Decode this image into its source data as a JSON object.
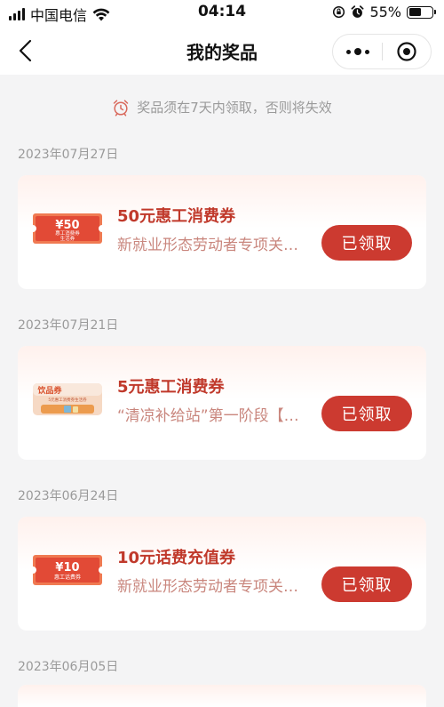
{
  "status_bar": {
    "carrier": "中国电信",
    "time": "04:14",
    "battery_percent": "55%",
    "battery_level": 0.55
  },
  "nav": {
    "title": "我的奖品"
  },
  "notice": {
    "text": "奖品须在7天内领取，否则将失效"
  },
  "colors": {
    "accent": "#cc3a30",
    "title_red": "#c0392b",
    "desc_pink": "#c9867d",
    "bg": "#f4f4f5"
  },
  "prizes": [
    {
      "date": "2023年07月27日",
      "title": "50元惠工消费券",
      "desc": "新就业形态劳动者专项关…",
      "button": "已领取",
      "thumb": {
        "type": "coupon",
        "value_text": "¥50",
        "caption1": "惠工消费券",
        "caption2": "生活券"
      }
    },
    {
      "date": "2023年07月21日",
      "title": "5元惠工消费券",
      "desc": "“清凉补给站”第一阶段【…",
      "button": "已领取",
      "thumb": {
        "type": "drink",
        "label": "饮品券",
        "caption": "5元惠工消费券生活券"
      }
    },
    {
      "date": "2023年06月24日",
      "title": "10元话费充值券",
      "desc": "新就业形态劳动者专项关…",
      "button": "已领取",
      "thumb": {
        "type": "coupon",
        "value_text": "¥10",
        "caption1": "惠工话费券"
      }
    },
    {
      "date": "2023年06月05日"
    }
  ]
}
